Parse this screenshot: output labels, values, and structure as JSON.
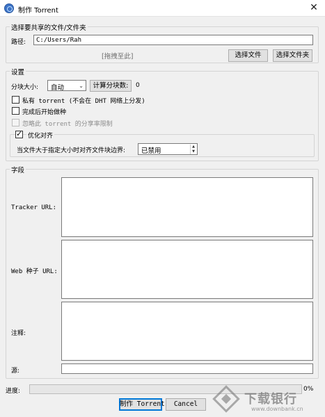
{
  "window": {
    "title": "制作 Torrent",
    "close_glyph": "✕"
  },
  "source_group": {
    "title": "选择要共享的文件/文件夹",
    "path_label": "路径:",
    "path_value": "C:/Users/Rah",
    "drag_hint": "[拖拽至此]",
    "select_file_button": "选择文件",
    "select_folder_button": "选择文件夹"
  },
  "settings_group": {
    "title": "设置",
    "piece_size_label": "分块大小:",
    "piece_size_value": "自动",
    "calc_pieces_button": "计算分块数:",
    "piece_count": "0",
    "private_torrent_label": "私有 torrent  (不会在 DHT 网络上分发)",
    "private_torrent_checked": false,
    "start_seeding_label": "完成后开始做种",
    "start_seeding_checked": false,
    "ignore_share_limit_label": "忽略此 torrent 的分享率限制",
    "ignore_share_limit_checked": false,
    "ignore_share_limit_disabled": true,
    "optimize_alignment_label": "优化对齐",
    "optimize_alignment_checked": true,
    "align_threshold_label": "当文件大于指定大小时对齐文件块边界:",
    "align_threshold_value": "已禁用"
  },
  "fields_group": {
    "title": "字段",
    "tracker_url_label": "Tracker URL:",
    "web_seed_label": "Web 种子 URL:",
    "comment_label": "注释:",
    "source_label": "源:"
  },
  "progress": {
    "label": "进度:",
    "percent_text": "0%",
    "value": 0
  },
  "actions": {
    "create_button": "制作 Torrent",
    "cancel_button": "Cancel"
  },
  "watermark": {
    "text_cn": "下载银行",
    "text_en": "www.downbank.cn"
  },
  "colors": {
    "accent": "#0078d7",
    "progress_fill": "#06b025",
    "background": "#f0f0f0"
  }
}
